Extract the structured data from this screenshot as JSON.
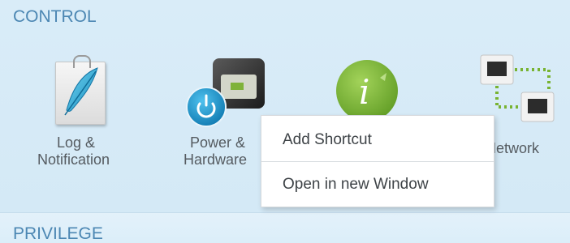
{
  "sections": {
    "control": "CONTROL",
    "privilege": "PRIVILEGE"
  },
  "apps": [
    {
      "label_line1": "Log &",
      "label_line2": "Notification",
      "icon": "feather-clipboard-icon"
    },
    {
      "label_line1": "Power &",
      "label_line2": "Hardware",
      "icon": "power-hardware-icon"
    },
    {
      "label_line1": "",
      "label_line2": "",
      "icon": "info-icon"
    },
    {
      "label_line1": "Network",
      "label_line2": "",
      "icon": "network-icon"
    }
  ],
  "context_menu": {
    "items": [
      {
        "label": "Add Shortcut"
      },
      {
        "label": "Open in new Window"
      }
    ]
  },
  "colors": {
    "panel_bg": "#d9ecf8",
    "section_title": "#4c87b3",
    "label_text": "#555b60",
    "menu_text": "#3e4347",
    "info_green": "#7db33a",
    "power_blue": "#1f8fc6",
    "network_green": "#78b332"
  }
}
